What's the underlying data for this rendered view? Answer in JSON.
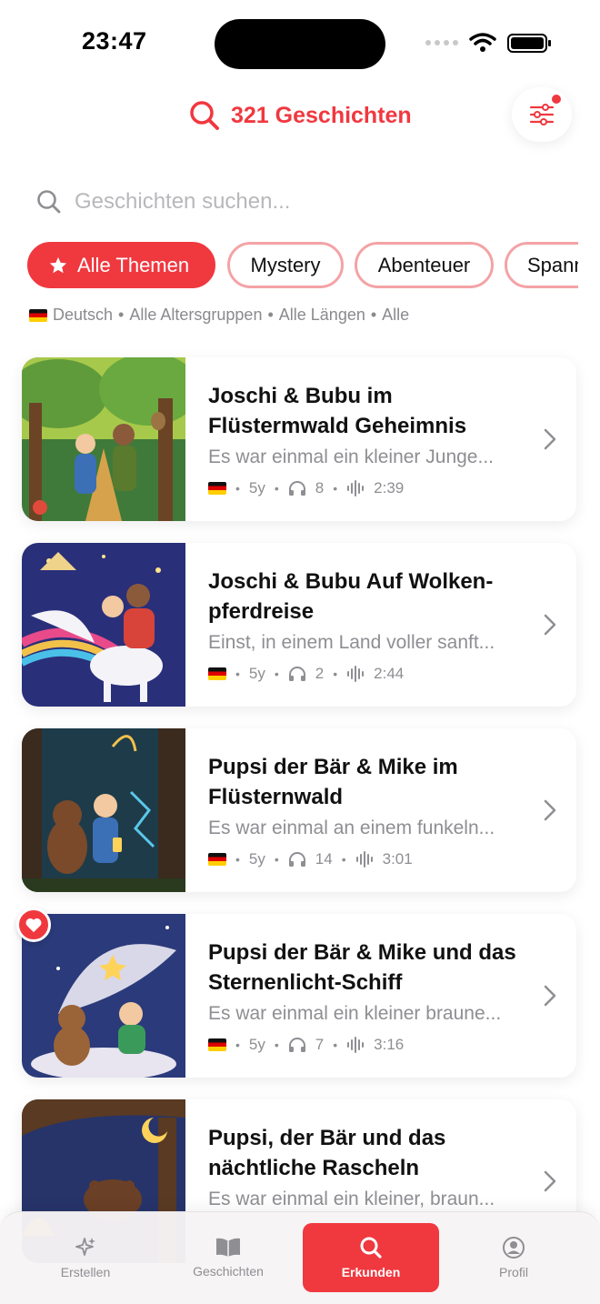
{
  "status_bar": {
    "time": "23:47"
  },
  "header": {
    "title": "321 Geschichten"
  },
  "search": {
    "placeholder": "Geschichten suchen..."
  },
  "chips": [
    {
      "label": "Alle Themen",
      "active": true
    },
    {
      "label": "Mystery",
      "active": false
    },
    {
      "label": "Abenteuer",
      "active": false
    },
    {
      "label": "Spann",
      "active": false
    }
  ],
  "filters": {
    "language": "Deutsch",
    "age": "Alle Altersgruppen",
    "length": "Alle Längen",
    "other": "Alle",
    "separator": "•"
  },
  "stories": [
    {
      "title": "Joschi & Bubu im Flüstermwald Geheimnis",
      "excerpt": "Es war einmal ein kleiner Junge...",
      "age": "5y",
      "listens": "8",
      "duration": "2:39",
      "favorite": false
    },
    {
      "title": "Joschi & Bubu Auf Wolken-pferdreise",
      "excerpt": "Einst, in einem Land voller sanft...",
      "age": "5y",
      "listens": "2",
      "duration": "2:44",
      "favorite": false
    },
    {
      "title": "Pupsi der Bär & Mike im Flüsternwald",
      "excerpt": "Es war einmal an einem funkeln...",
      "age": "5y",
      "listens": "14",
      "duration": "3:01",
      "favorite": false
    },
    {
      "title": "Pupsi der Bär & Mike und das Sternenlicht-Schiff",
      "excerpt": "Es war einmal ein kleiner braune...",
      "age": "5y",
      "listens": "7",
      "duration": "3:16",
      "favorite": true
    },
    {
      "title": "Pupsi, der Bär und das nächtliche Rascheln",
      "excerpt": "Es war einmal ein kleiner, braun...",
      "age": "",
      "listens": "",
      "duration": "",
      "favorite": false
    }
  ],
  "tabbar": {
    "items": [
      {
        "label": "Erstellen",
        "icon": "sparkles-icon",
        "active": false
      },
      {
        "label": "Geschichten",
        "icon": "book-icon",
        "active": false
      },
      {
        "label": "Erkunden",
        "icon": "search-icon",
        "active": true
      },
      {
        "label": "Profil",
        "icon": "person-icon",
        "active": false
      }
    ]
  },
  "colors": {
    "accent": "#f0383f",
    "chip_border": "#f4a3a6",
    "muted": "#8e8e93"
  }
}
